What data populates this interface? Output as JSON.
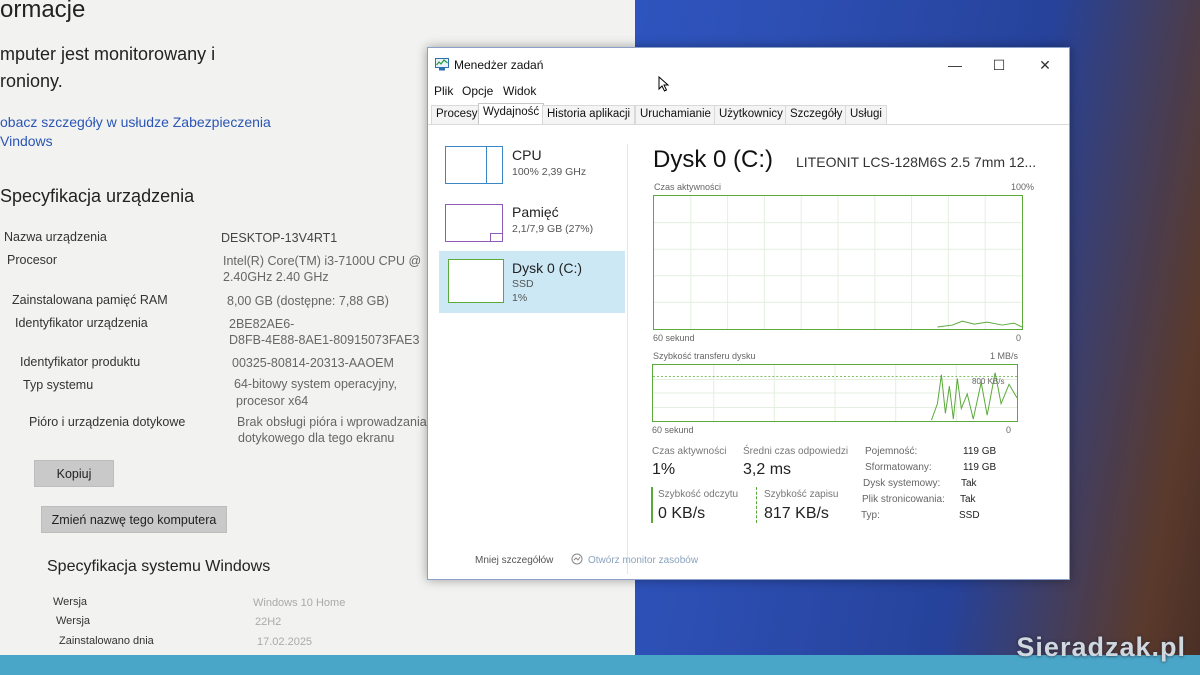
{
  "settings": {
    "heading_partial": "ormacje",
    "status_line1": "mputer jest monitorowany i",
    "status_line2": "roniony.",
    "security_link_line1": "obacz szczegóły w usłudze Zabezpieczenia",
    "security_link_line2": "Vindows",
    "device_spec_title": "Specyfikacja urządzenia",
    "specs": [
      {
        "label": "Nazwa urządzenia",
        "value": "DESKTOP-13V4RT1",
        "value2": ""
      },
      {
        "label": "Procesor",
        "value": "Intel(R) Core(TM) i3-7100U CPU @",
        "value2": "2.40GHz   2.40 GHz"
      },
      {
        "label": "Zainstalowana pamięć RAM",
        "value": "8,00 GB (dostępne: 7,88 GB)",
        "value2": ""
      },
      {
        "label": "Identyfikator urządzenia",
        "value": "2BE82AE6-",
        "value2": "D8FB-4E88-8AE1-80915073FAE3"
      },
      {
        "label": "Identyfikator produktu",
        "value": "00325-80814-20313-AAOEM",
        "value2": ""
      },
      {
        "label": "Typ systemu",
        "value": "64-bitowy system operacyjny,",
        "value2": "procesor x64"
      },
      {
        "label": "Pióro i urządzenia dotykowe",
        "value": "Brak obsługi pióra i wprowadzania",
        "value2": "dotykowego dla tego ekranu"
      }
    ],
    "copy_button": "Kopiuj",
    "rename_button": "Zmień nazwę tego komputera",
    "windows_spec_title": "Specyfikacja systemu Windows",
    "win_specs": [
      {
        "label": "Wersja",
        "value": "Windows 10 Home"
      },
      {
        "label": "Wersja",
        "value": "22H2"
      },
      {
        "label": "Zainstalowano dnia",
        "value": "17.02.2025"
      }
    ]
  },
  "taskmgr": {
    "title": "Menedżer zadań",
    "menu": [
      "Plik",
      "Opcje",
      "Widok"
    ],
    "window_buttons": {
      "minimize": "—",
      "maximize": "☐",
      "close": "✕"
    },
    "tabs": [
      "Procesy",
      "Wydajność",
      "Historia aplikacji",
      "Uruchamianie",
      "Użytkownicy",
      "Szczegóły",
      "Usługi"
    ],
    "active_tab": "Wydajność",
    "sidebar": [
      {
        "name": "CPU",
        "sub1": "100%  2,39 GHz",
        "sub2": ""
      },
      {
        "name": "Pamięć",
        "sub1": "2,1/7,9 GB (27%)",
        "sub2": ""
      },
      {
        "name": "Dysk 0 (C:)",
        "sub1": "SSD",
        "sub2": "1%"
      }
    ],
    "disk": {
      "title": "Dysk 0 (C:)",
      "model": "LITEONIT LCS-128M6S 2.5 7mm 12...",
      "activity_label": "Czas aktywności",
      "activity_max": "100%",
      "time_left": "60 sekund",
      "time_right": "0",
      "transfer_label": "Szybkość transferu dysku",
      "transfer_max": "1 MB/s",
      "transfer_mark": "800 KB/s",
      "transfer_time_left": "60 sekund",
      "transfer_time_right": "0",
      "stats": {
        "active_label": "Czas aktywności",
        "active_value": "1%",
        "response_label": "Średni czas odpowiedzi",
        "response_value": "3,2 ms",
        "read_label": "Szybkość odczytu",
        "read_value": "0 KB/s",
        "write_label": "Szybkość zapisu",
        "write_value": "817 KB/s"
      },
      "props": [
        {
          "label": "Pojemność:",
          "value": "119 GB"
        },
        {
          "label": "Sformatowany:",
          "value": "119 GB"
        },
        {
          "label": "Dysk systemowy:",
          "value": "Tak"
        },
        {
          "label": "Plik stronicowania:",
          "value": "Tak"
        },
        {
          "label": "Typ:",
          "value": "SSD"
        }
      ]
    },
    "footer": {
      "fewer_details": "Mniej szczegółów",
      "resource_monitor": "Otwórz monitor zasobów"
    }
  },
  "watermark": "Sieradzak.pl",
  "colors": {
    "graph_border": "#5aa93a",
    "selected_side": "#cce8f5",
    "thumb_border": "#3b86c4"
  }
}
